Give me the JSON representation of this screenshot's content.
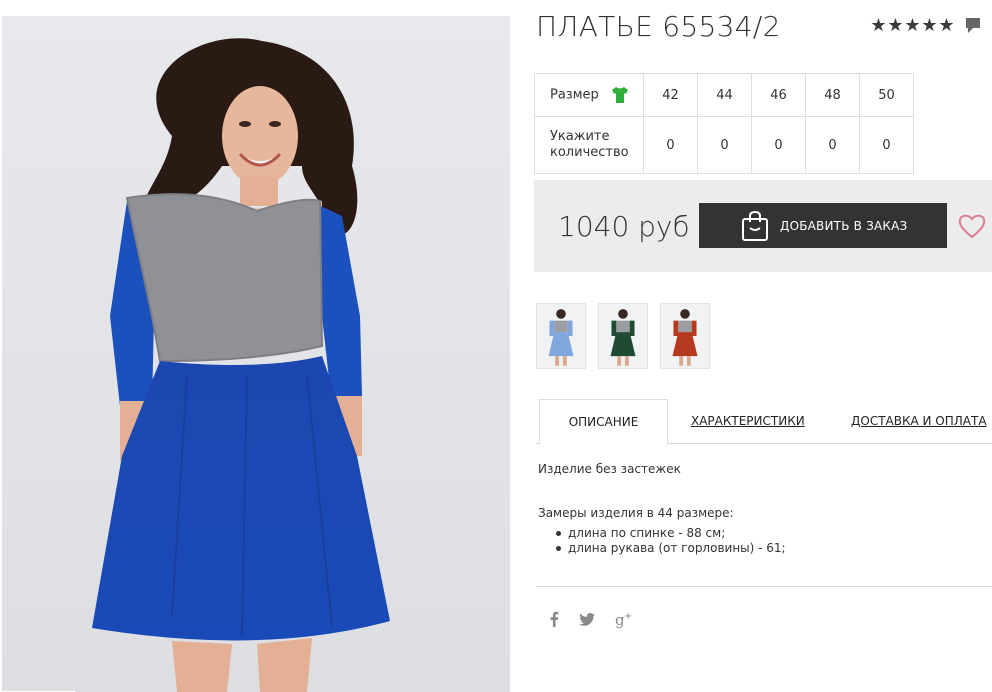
{
  "product": {
    "title": "ПЛАТЬЕ 65534/2",
    "rating_stars": 5,
    "rating_icon": "star-icon",
    "comment_icon": "comment-icon"
  },
  "size_table": {
    "size_label": "Размер",
    "qty_label_line1": "Укажите",
    "qty_label_line2": "количество",
    "sizes": [
      "42",
      "44",
      "46",
      "48",
      "50"
    ],
    "quantities": [
      "0",
      "0",
      "0",
      "0",
      "0"
    ],
    "size_icon": "green-shirt-icon"
  },
  "purchase": {
    "price": "1040 руб",
    "add_button_label": "ДОБАВИТЬ В ЗАКАЗ",
    "bag_icon": "shopping-bag-icon",
    "wishlist_icon": "heart-icon"
  },
  "thumbnails": [
    {
      "name": "thumbnail-light-blue",
      "color": "#7fa7dd"
    },
    {
      "name": "thumbnail-green",
      "color": "#1f4a34"
    },
    {
      "name": "thumbnail-red",
      "color": "#b5391e"
    }
  ],
  "tabs": {
    "description": "ОПИСАНИЕ",
    "characteristics": "ХАРАКТЕРИСТИКИ",
    "delivery": "ДОСТАВКА И ОПЛАТА",
    "active": "description"
  },
  "description": {
    "line1": "Изделие без застежек",
    "measures_title": "Замеры изделия в 44 размере:",
    "items": [
      "длина по спинке - 88 см;",
      "длина рукава (от горловины) - 61;"
    ]
  },
  "social": {
    "icons": [
      "facebook-icon",
      "twitter-icon",
      "google-plus-icon"
    ]
  },
  "photo": {
    "corner_text": ".."
  },
  "colors": {
    "dress_blue": "#1e4fba",
    "top_grey": "#8d8f94",
    "button_dark": "#333333",
    "panel_grey": "#ececec",
    "heart_pink": "#d97f8f",
    "shirt_green": "#2fae3c"
  }
}
